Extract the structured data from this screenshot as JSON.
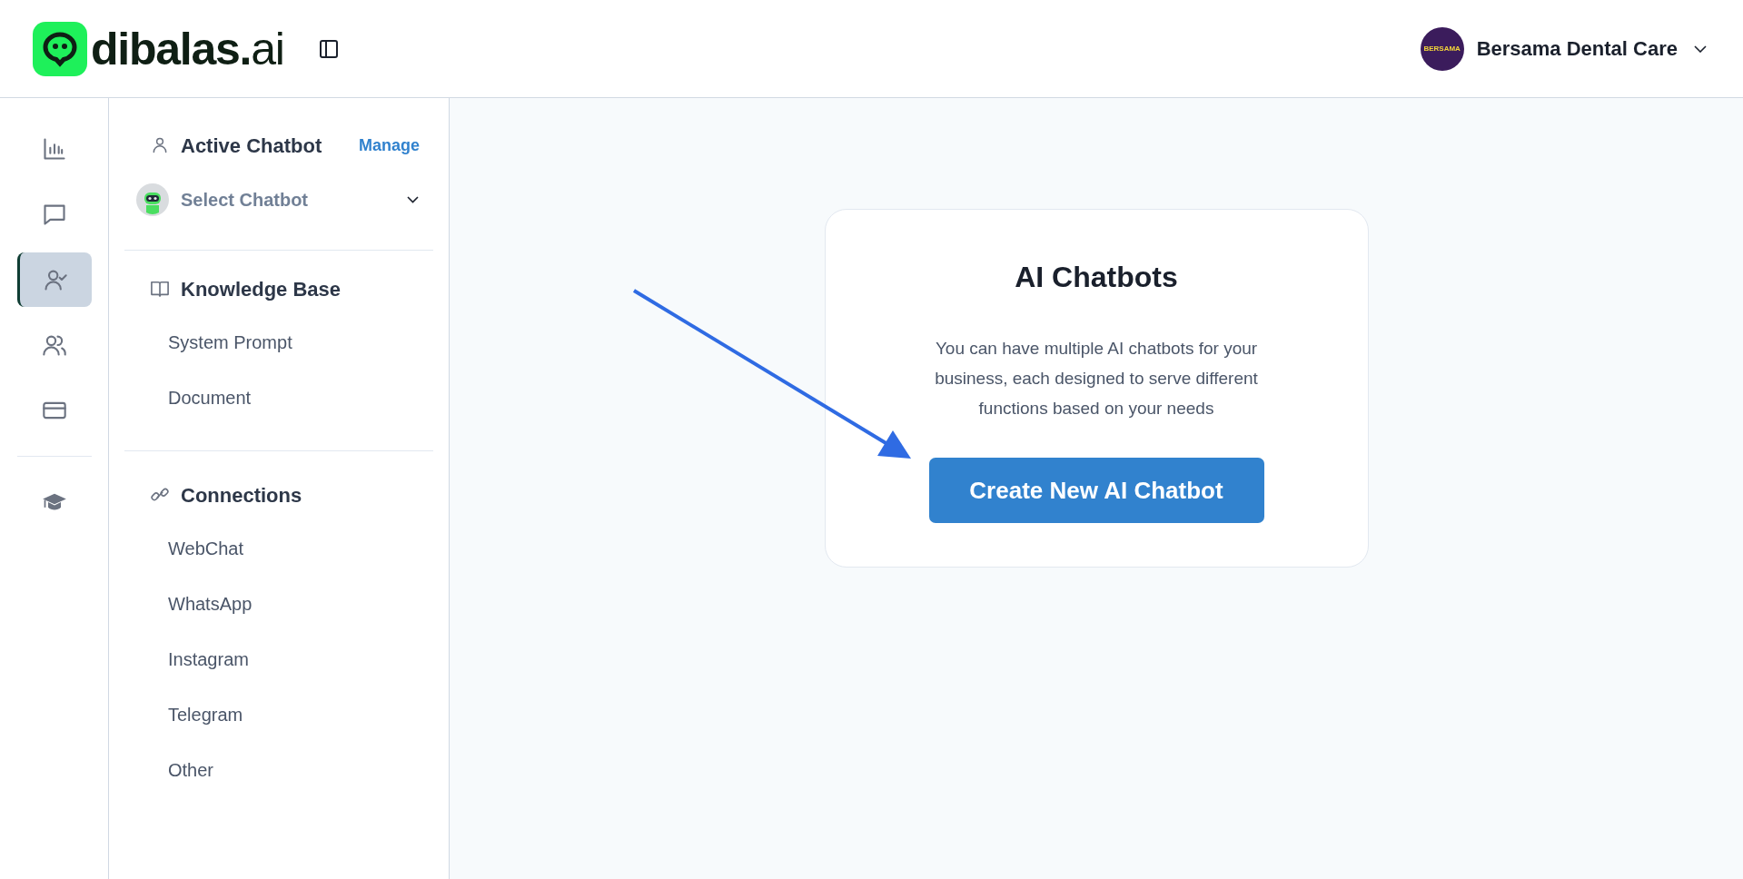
{
  "logo": {
    "name": "dibalas.",
    "suffix": "ai"
  },
  "account": {
    "avatar_text": "BERSAMA",
    "name": "Bersama Dental Care"
  },
  "rail_groups": [
    [
      {
        "selected": false
      },
      {
        "selected": false
      },
      {
        "selected": true
      },
      {
        "selected": false
      },
      {
        "selected": false
      }
    ],
    [
      {
        "selected": false
      }
    ]
  ],
  "sidebar": {
    "sections": [
      {
        "title": "Active Chatbot",
        "action": "Manage",
        "select": {
          "label": "Select Chatbot"
        }
      },
      {
        "title": "Knowledge Base",
        "items": [
          "System Prompt",
          "Document"
        ]
      },
      {
        "title": "Connections",
        "items": [
          "WebChat",
          "WhatsApp",
          "Instagram",
          "Telegram",
          "Other"
        ]
      }
    ]
  },
  "card": {
    "title": "AI Chatbots",
    "text": "You can have multiple AI chatbots for your business, each designed to serve different functions based on your needs",
    "button": "Create New AI Chatbot"
  }
}
